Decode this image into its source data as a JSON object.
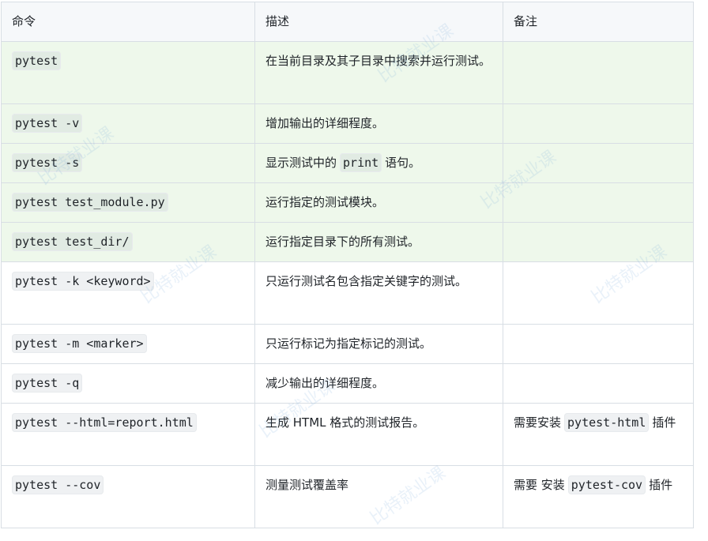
{
  "headers": [
    "命令",
    "描述",
    "备注"
  ],
  "rows": [
    {
      "cmd": "pytest",
      "desc": "在当前目录及其子目录中搜索并运行测试。",
      "note": ""
    },
    {
      "cmd": "pytest -v",
      "desc": "增加输出的详细程度。",
      "note": ""
    },
    {
      "cmd": "pytest -s",
      "desc_pre": "显示测试中的",
      "desc_code": "print",
      "desc_post": "语句。",
      "note": ""
    },
    {
      "cmd": "pytest test_module.py",
      "desc": "运行指定的测试模块。",
      "note": ""
    },
    {
      "cmd": "pytest test_dir/",
      "desc": "运行指定目录下的所有测试。",
      "note": ""
    },
    {
      "cmd": "pytest -k <keyword>",
      "desc": "只运行测试名包含指定关键字的测试。",
      "note": ""
    },
    {
      "cmd": "pytest -m <marker>",
      "desc": "只运行标记为指定标记的测试。",
      "note": ""
    },
    {
      "cmd": "pytest -q",
      "desc": "减少输出的详细程度。",
      "note": ""
    },
    {
      "cmd": "pytest --html=report.html",
      "desc": "生成 HTML 格式的测试报告。",
      "note_pre": "需要安装",
      "note_code": "pytest-html",
      "note_post": "插件"
    },
    {
      "cmd": "pytest --cov",
      "desc": "测量测试覆盖率",
      "note_pre": "需要 安装",
      "note_code": "pytest-cov",
      "note_post": "插件"
    }
  ],
  "watermark": "比特就业课"
}
